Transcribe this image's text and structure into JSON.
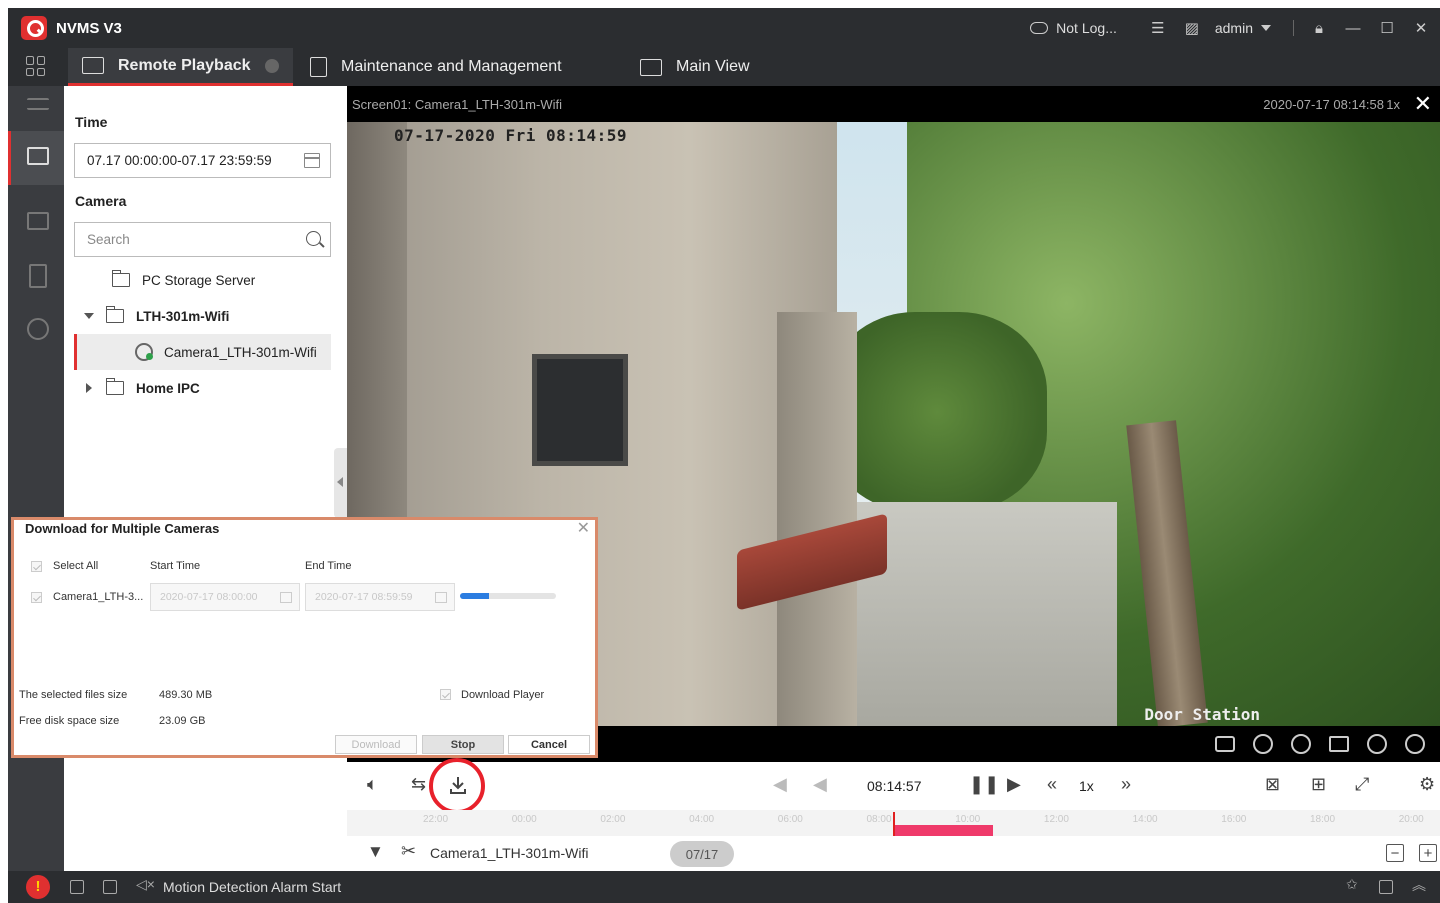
{
  "app": {
    "title": "NVMS V3"
  },
  "titlebar": {
    "status": "Not Log...",
    "user": "admin"
  },
  "tabs": [
    {
      "label": "Remote Playback"
    },
    {
      "label": "Maintenance and Management"
    },
    {
      "label": "Main View"
    }
  ],
  "left_panel": {
    "time_label": "Time",
    "time_range": "07.17 00:00:00-07.17 23:59:59",
    "camera_label": "Camera",
    "search_placeholder": "Search",
    "tree": [
      {
        "label": "PC Storage Server"
      },
      {
        "label": "LTH-301m-Wifi"
      },
      {
        "label": "Camera1_LTH-301m-Wifi"
      },
      {
        "label": "Home IPC"
      }
    ]
  },
  "video": {
    "screen_label": "Screen01: Camera1_LTH-301m-Wifi",
    "datetime": "2020-07-17 08:14:58",
    "speed": "1x",
    "overlay_timestamp": "07-17-2020 Fri 08:14:59",
    "overlay_label": "Door Station"
  },
  "playback": {
    "time": "08:14:57",
    "speed": "1x",
    "camera": "Camera1_LTH-301m-Wifi",
    "date": "07/17",
    "timeline_ticks": [
      "22:00",
      "00:00",
      "02:00",
      "04:00",
      "06:00",
      "08:00",
      "10:00",
      "12:00",
      "14:00",
      "16:00",
      "18:00",
      "20:00"
    ]
  },
  "dialog": {
    "title": "Download for Multiple Cameras",
    "select_all": "Select All",
    "start_time_header": "Start Time",
    "end_time_header": "End Time",
    "row_camera": "Camera1_LTH-3...",
    "row_start": "2020-07-17 08:00:00",
    "row_end": "2020-07-17 08:59:59",
    "progress": 0.3,
    "selected_size_label": "The selected files size",
    "selected_size": "489.30 MB",
    "free_space_label": "Free disk space size",
    "free_space": "23.09 GB",
    "download_player": "Download Player",
    "download_button": "Download",
    "stop_button": "Stop",
    "cancel_button": "Cancel"
  },
  "statusbar": {
    "message": "Motion Detection Alarm  Start"
  },
  "colors": {
    "accent": "#e03030",
    "highlight_circle": "#e8212b",
    "record_segment": "#ef3a6a",
    "progress": "#2b7de1"
  }
}
